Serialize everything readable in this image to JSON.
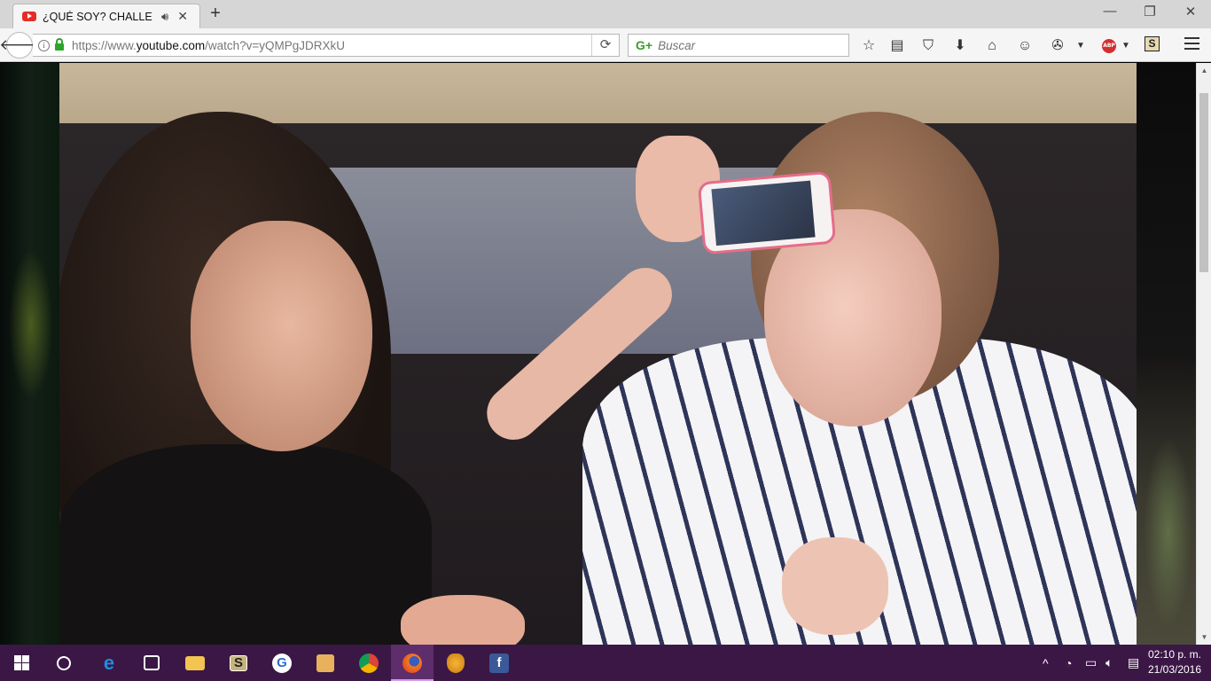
{
  "browser": {
    "tab": {
      "title": "¿QUÉ SOY? CHALLEN...",
      "audio_icon": "speaker-icon",
      "close_glyph": "✕"
    },
    "new_tab_glyph": "+",
    "window_controls": {
      "minimize": "—",
      "restore": "❐",
      "close": "✕"
    },
    "url": {
      "scheme": "https://www.",
      "host": "youtube.com",
      "path": "/watch?v=yQMPgJDRXkU"
    },
    "search": {
      "placeholder": "Buscar"
    },
    "toolbar_icons": [
      "bookmark-star-icon",
      "reading-list-icon",
      "pocket-icon",
      "download-icon",
      "home-icon",
      "hello-icon",
      "extension-icon",
      "menu-arrow-icon",
      "adblock-plus-icon",
      "s-extension-icon",
      "hamburger-menu-icon"
    ],
    "adblock_label": "ABP",
    "s_extension_label": "S"
  },
  "taskbar": {
    "apps": [
      "start-button",
      "cortana-search",
      "edge",
      "store",
      "file-explorer",
      "app-s",
      "app-g",
      "media-player",
      "chrome",
      "firefox",
      "fl-studio",
      "facebook"
    ],
    "clock": {
      "time": "02:10 p. m.",
      "date": "21/03/2016"
    }
  },
  "colors": {
    "tab_strip": "#d6d6d6",
    "taskbar": "#3b1746",
    "youtube_red": "#e52d27",
    "lock_green": "#2da52a"
  }
}
